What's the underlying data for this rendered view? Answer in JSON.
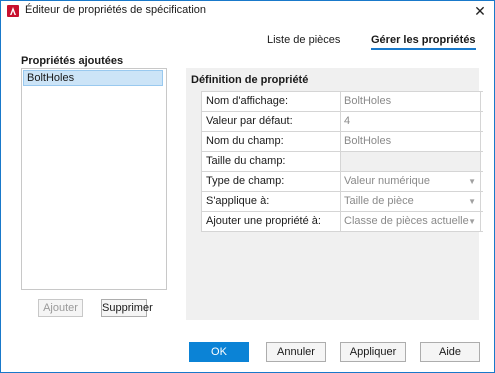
{
  "window": {
    "title": "Éditeur de propriétés de spécification",
    "close_label": "✕"
  },
  "tabs": [
    {
      "label": "Liste de pièces",
      "active": false
    },
    {
      "label": "Gérer les propriétés",
      "active": true
    }
  ],
  "added_properties": {
    "heading": "Propriétés ajoutées",
    "items": [
      "BoltHoles"
    ],
    "selected": "BoltHoles",
    "add_label": "Ajouter",
    "add_enabled": false,
    "remove_label": "Supprimer"
  },
  "definition": {
    "heading": "Définition de propriété",
    "rows": [
      {
        "label": "Nom d'affichage:",
        "value": "BoltHoles",
        "type": "text"
      },
      {
        "label": "Valeur par défaut:",
        "value": "4",
        "type": "text"
      },
      {
        "label": "Nom du champ:",
        "value": "BoltHoles",
        "type": "text"
      },
      {
        "label": "Taille du champ:",
        "value": "",
        "type": "text"
      },
      {
        "label": "Type de champ:",
        "value": "Valeur numérique",
        "type": "dropdown"
      },
      {
        "label": "S'applique à:",
        "value": "Taille de pièce",
        "type": "dropdown"
      },
      {
        "label": "Ajouter une propriété à:",
        "value": "Classe de pièces actuelle",
        "type": "dropdown"
      }
    ]
  },
  "footer": {
    "ok_label": "OK",
    "cancel_label": "Annuler",
    "apply_label": "Appliquer",
    "help_label": "Aide"
  },
  "colors": {
    "accent": "#1979ca",
    "primary_button": "#0b83d6",
    "selection": "#cce4f7"
  }
}
